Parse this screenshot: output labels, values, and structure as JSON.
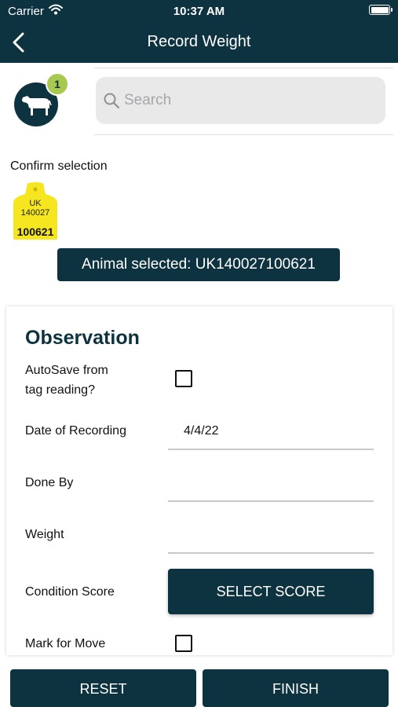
{
  "status_bar": {
    "carrier": "Carrier",
    "time": "10:37 AM",
    "icons": [
      "wifi-icon",
      "battery-icon"
    ]
  },
  "nav": {
    "back_icon": "chevron-left-icon",
    "title": "Record Weight"
  },
  "selection": {
    "avatar_icon": "cow-icon",
    "badge_count": "1"
  },
  "search": {
    "icon": "search-icon",
    "placeholder": "Search"
  },
  "confirm_label": "Confirm selection",
  "ear_tag": {
    "line1": "UK",
    "line2": "140027",
    "line3": "100621",
    "color": "#f5e61f"
  },
  "banner": {
    "text": "Animal selected: UK140027100621"
  },
  "observation": {
    "title": "Observation",
    "autosave_line1": "AutoSave from",
    "autosave_line2": "tag reading?",
    "autosave_checked": false,
    "date_label": "Date of Recording",
    "date_value": "4/4/22",
    "done_by_label": "Done By",
    "done_by_value": "",
    "weight_label": "Weight",
    "weight_value": "",
    "condition_label": "Condition Score",
    "select_score_label": "SELECT SCORE",
    "mark_move_label": "Mark for Move",
    "mark_move_checked": false
  },
  "footer": {
    "reset_label": "RESET",
    "finish_label": "FINISH"
  },
  "colors": {
    "primary": "#0e3340",
    "badge": "#a8c94f",
    "tag_yellow": "#f5e61f"
  }
}
